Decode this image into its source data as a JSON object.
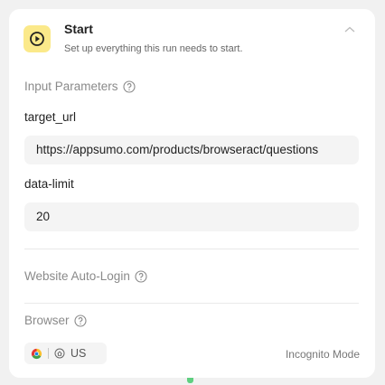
{
  "node": {
    "title": "Start",
    "subtitle": "Set up everything this run needs to start."
  },
  "input_parameters": {
    "label": "Input Parameters",
    "fields": [
      {
        "label": "target_url",
        "value": "https://appsumo.com/products/browseract/questions"
      },
      {
        "label": "data-limit",
        "value": "20"
      }
    ]
  },
  "website_login": {
    "label": "Website Auto-Login"
  },
  "browser": {
    "label": "Browser",
    "region": "US",
    "mode": "Incognito Mode"
  },
  "icons": {
    "start": "play-circle-icon",
    "collapse": "chevron-up-icon",
    "help": "question-circle-icon",
    "browser": "chrome-icon",
    "home": "home-icon"
  },
  "colors": {
    "start_badge": "#fbe98a",
    "connector": "#5fcf80"
  }
}
